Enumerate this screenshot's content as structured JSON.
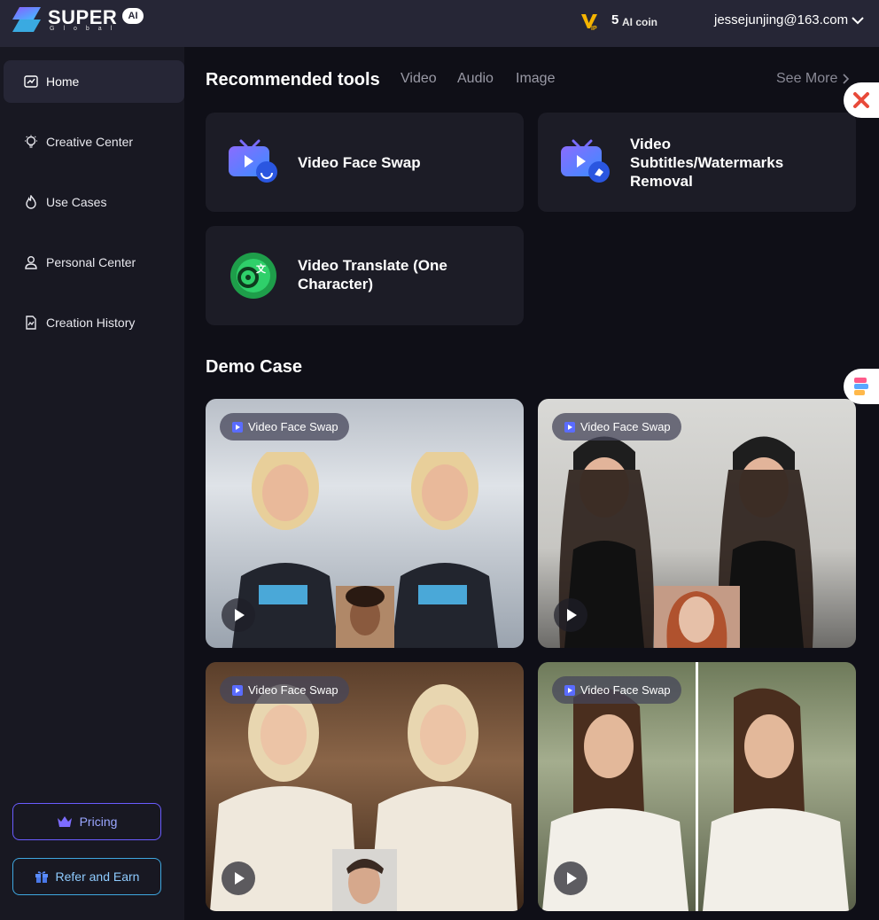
{
  "header": {
    "brand": "SUPER",
    "brand_badge": "AI",
    "brand_sub": "Global",
    "coin_count": "5",
    "coin_label": "AI coin",
    "user_email": "jessejunjing@163.com"
  },
  "sidebar": {
    "items": [
      {
        "label": "Home",
        "icon": "chart-icon",
        "active": true
      },
      {
        "label": "Creative Center",
        "icon": "lightbulb-icon"
      },
      {
        "label": "Use Cases",
        "icon": "flame-icon"
      },
      {
        "label": "Personal Center",
        "icon": "user-icon"
      },
      {
        "label": "Creation History",
        "icon": "history-icon"
      }
    ],
    "pricing_label": "Pricing",
    "refer_label": "Refer and Earn"
  },
  "tools": {
    "title": "Recommended tools",
    "tabs": [
      "Video",
      "Audio",
      "Image"
    ],
    "see_more": "See More",
    "cards": [
      {
        "label": "Video Face Swap",
        "icon": "tv-face-icon"
      },
      {
        "label": "Video Subtitles/Watermarks Removal",
        "icon": "tv-eraser-icon"
      },
      {
        "label": "Video Translate (One Character)",
        "icon": "translate-icon"
      }
    ]
  },
  "demo": {
    "title": "Demo Case",
    "cards": [
      {
        "badge": "Video Face Swap"
      },
      {
        "badge": "Video Face Swap"
      },
      {
        "badge": "Video Face Swap"
      },
      {
        "badge": "Video Face Swap"
      }
    ]
  },
  "colors": {
    "background": "#0f0f17",
    "header": "#262636",
    "sidebar": "#181822",
    "card": "#1c1c26",
    "accent": "#6a5cff"
  }
}
